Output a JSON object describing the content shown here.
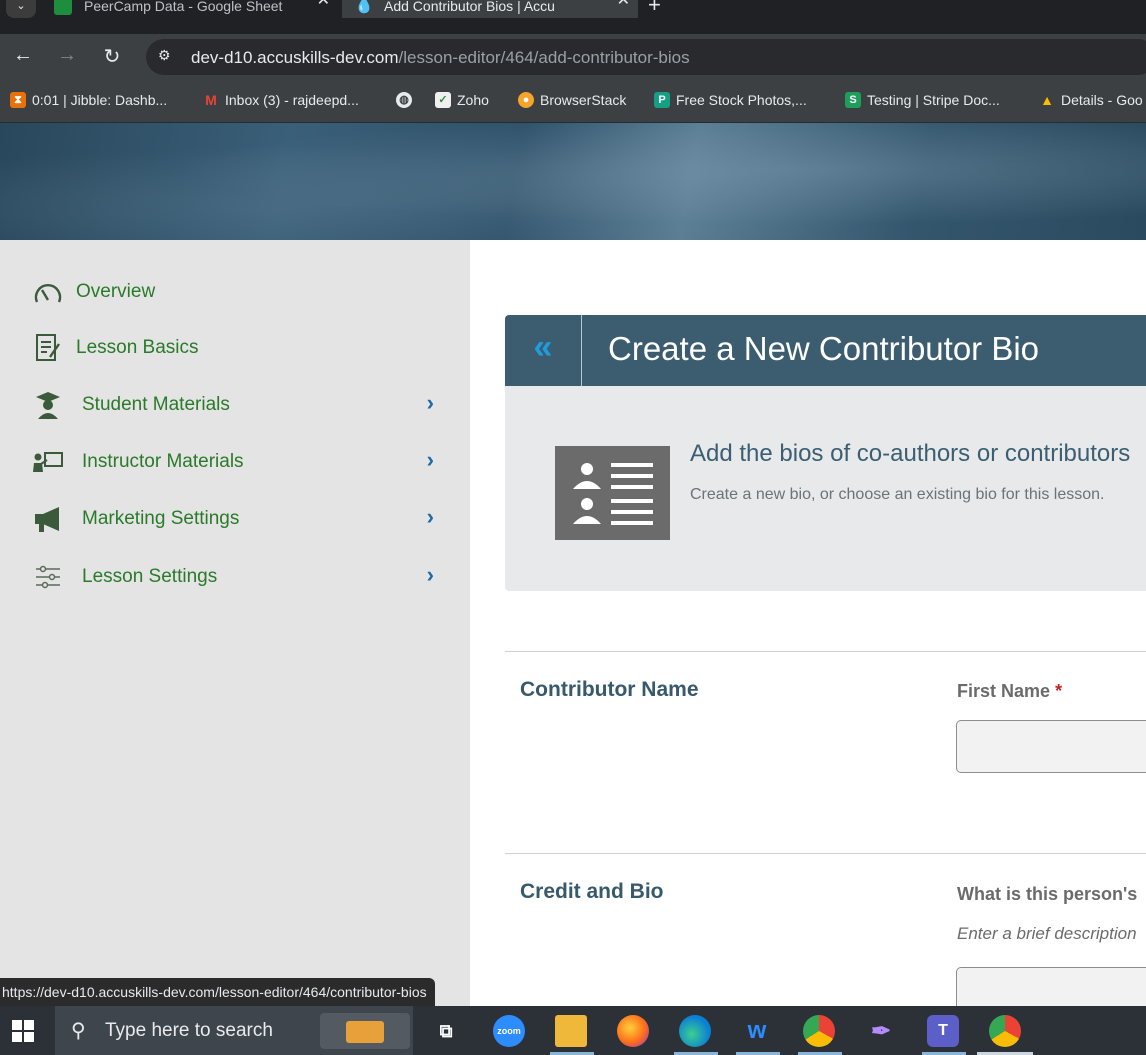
{
  "browser": {
    "tabs": [
      {
        "title": "PeerCamp Data - Google Sheet",
        "active": false
      },
      {
        "title": "Add Contributor Bios | Accu",
        "active": true
      }
    ],
    "url_host": "dev-d10.accuskills-dev.com",
    "url_path": "/lesson-editor/464/add-contributor-bios",
    "bookmarks": [
      {
        "label": "0:01 | Jibble: Dashb...",
        "icon": "hourglass-icon",
        "color": "#e8710a"
      },
      {
        "label": "Inbox (3) - rajdeepd...",
        "icon": "gmail-icon",
        "color": "#ea4335"
      },
      {
        "label": "",
        "icon": "globe-icon",
        "color": "#e8eaed"
      },
      {
        "label": "Zoho",
        "icon": "zoho-icon",
        "color": "#f0f0f0"
      },
      {
        "label": "BrowserStack",
        "icon": "browserstack-icon",
        "color": "#f4a52a"
      },
      {
        "label": "Free Stock Photos,...",
        "icon": "pexels-icon",
        "color": "#15a085"
      },
      {
        "label": "Testing | Stripe Doc...",
        "icon": "stripe-icon",
        "color": "#1e9e5a"
      },
      {
        "label": "Details - Goo",
        "icon": "google-drive-icon",
        "color": "#fbbc04"
      }
    ]
  },
  "sidebar": {
    "items": [
      {
        "label": "Overview",
        "icon": "gauge-icon",
        "expandable": false
      },
      {
        "label": "Lesson Basics",
        "icon": "document-edit-icon",
        "expandable": false
      },
      {
        "label": "Student Materials",
        "icon": "graduate-icon",
        "expandable": true
      },
      {
        "label": "Instructor Materials",
        "icon": "teacher-board-icon",
        "expandable": true
      },
      {
        "label": "Marketing Settings",
        "icon": "megaphone-icon",
        "expandable": true
      },
      {
        "label": "Lesson Settings",
        "icon": "sliders-icon",
        "expandable": true
      }
    ]
  },
  "panel": {
    "back_symbol": "«",
    "title": "Create a New Contributor Bio",
    "intro_heading": "Add the bios of co-authors or contributors",
    "intro_subtext": "Create a new bio, or choose an existing bio for this lesson."
  },
  "form": {
    "contributor_name": {
      "section_label": "Contributor Name",
      "first_name_label": "First Name",
      "required_mark": "*",
      "first_name_value": ""
    },
    "credit_bio": {
      "section_label": "Credit and Bio",
      "question_label": "What is this person's",
      "hint": "Enter a brief description"
    }
  },
  "status_bar": {
    "link_preview": "https://dev-d10.accuskills-dev.com/lesson-editor/464/contributor-bios"
  },
  "taskbar": {
    "search_placeholder": "Type here to search",
    "apps": [
      "task-view-icon",
      "zoom-icon",
      "file-explorer-icon",
      "firefox-icon",
      "edge-icon",
      "app-w-icon",
      "chrome-profile-icon",
      "feather-icon",
      "teams-icon",
      "chrome-icon"
    ],
    "zoom_label": "zoom"
  },
  "colors": {
    "sidebar_text": "#2a7a2a",
    "panel_header": "#3c5d70",
    "accent_blue": "#1f9be0",
    "required_red": "#c81e1e"
  }
}
